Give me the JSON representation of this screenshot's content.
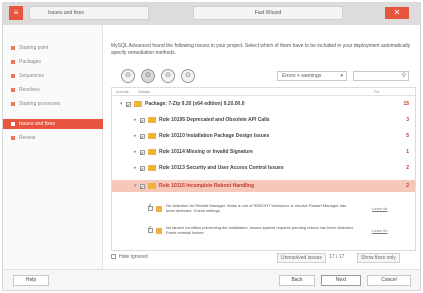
{
  "window": {
    "tab_left": "Issues and fixes",
    "tab_center": "Fast Wizard",
    "close": "✕",
    "app_icon": "≡"
  },
  "nav": {
    "items": [
      {
        "label": "Starting point"
      },
      {
        "label": "Packages"
      },
      {
        "label": "Sequences"
      },
      {
        "label": "Resolves"
      },
      {
        "label": "Starting processes"
      },
      {
        "label": "Issues and fixes"
      },
      {
        "label": "Review"
      }
    ],
    "active_index": 5
  },
  "intro": "MySQL Advanced found the following issues in your project. Select which of them have to be included in your deployment automatically specify remediation methods.",
  "toolbar": {
    "buttons": [
      "⊙",
      "⊙",
      "⊙",
      "⊙"
    ],
    "filter_label": "Errors + warnings",
    "filter_arrow": "▾",
    "search_icon": "⚲"
  },
  "list": {
    "headers": {
      "include": "Include",
      "details": "Details",
      "fix": "Fix"
    },
    "package_row": {
      "label": "Package: 7-Zip 9.20 (x64 edition) 9.20.00.0",
      "count": "15"
    },
    "rules": [
      {
        "label": "Rule 10195 Deprecated and Obsolete API Calls",
        "count": "3"
      },
      {
        "label": "Rule 10110 Installation Package Design Issues",
        "count": "5"
      },
      {
        "label": "Rule 10114 Missing or Invalid Signature",
        "count": "1"
      },
      {
        "label": "Rule 10113 Security and User Access Control Issues",
        "count": "2"
      },
      {
        "label": "Rule 10115 Incomplete Reboot Handling",
        "count": "2"
      }
    ],
    "details": [
      {
        "text": "No detection for Restart Manager. Make a rule of REBOOT behaviour or resolve Restart Manager has been detected. Check settings.",
        "link": "Learn fix"
      },
      {
        "text": "No launch condition preventing the installation, Issues system requires pending reboot has been detected. Fresh reinstall before.",
        "link": "Learn fix"
      }
    ]
  },
  "bottom": {
    "hide_ignored": "Hide Ignored",
    "status_a": "Unresolved issues",
    "status_b": "17 / 17",
    "status_c": "Show fixes only"
  },
  "footer": {
    "help": "Help",
    "back": "Back",
    "next": "Next",
    "cancel": "Cancel"
  }
}
